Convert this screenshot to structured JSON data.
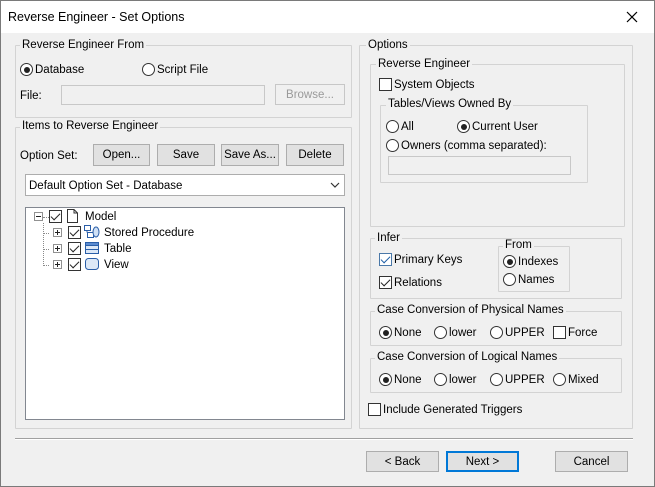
{
  "window": {
    "title": "Reverse Engineer - Set Options",
    "close_glyph": "✕"
  },
  "source": {
    "group_label": "Reverse Engineer From",
    "database_label": "Database",
    "database_selected": true,
    "script_label": "Script File",
    "script_selected": false,
    "file_label": "File:",
    "file_value": "",
    "browse_label": "Browse..."
  },
  "items": {
    "group_label": "Items to Reverse Engineer",
    "option_set_label": "Option Set:",
    "open_label": "Open...",
    "save_label": "Save",
    "save_as_label": "Save As...",
    "delete_label": "Delete",
    "option_set_value": "Default Option Set - Database",
    "tree": [
      {
        "label": "Model",
        "icon": "document-icon",
        "checked": true,
        "expander": "minus"
      },
      {
        "label": "Stored Procedure",
        "icon": "stored-procedure-icon",
        "checked": true,
        "expander": "plus"
      },
      {
        "label": "Table",
        "icon": "table-icon",
        "checked": true,
        "expander": "plus"
      },
      {
        "label": "View",
        "icon": "view-icon",
        "checked": true,
        "expander": "plus"
      }
    ]
  },
  "options": {
    "group_label": "Options",
    "reverse_engineer": {
      "group_label": "Reverse Engineer",
      "system_objects_label": "System Objects",
      "system_objects_checked": false,
      "owned_by": {
        "group_label": "Tables/Views Owned By",
        "all_label": "All",
        "current_user_label": "Current User",
        "owners_label": "Owners (comma separated):",
        "selected": "current_user",
        "owners_value": ""
      }
    },
    "infer": {
      "group_label": "Infer",
      "primary_keys_label": "Primary Keys",
      "primary_keys_checked": true,
      "relations_label": "Relations",
      "relations_checked": true,
      "from": {
        "group_label": "From",
        "indexes_label": "Indexes",
        "names_label": "Names",
        "selected": "indexes"
      }
    },
    "physical_case": {
      "group_label": "Case Conversion of Physical Names",
      "none_label": "None",
      "lower_label": "lower",
      "upper_label": "UPPER",
      "force_label": "Force",
      "selected": "none",
      "force_checked": false
    },
    "logical_case": {
      "group_label": "Case Conversion of Logical Names",
      "none_label": "None",
      "lower_label": "lower",
      "upper_label": "UPPER",
      "mixed_label": "Mixed",
      "selected": "none"
    },
    "include_triggers_label": "Include Generated Triggers",
    "include_triggers_checked": false
  },
  "footer": {
    "back_label": "< Back",
    "next_label": "Next >",
    "cancel_label": "Cancel"
  }
}
